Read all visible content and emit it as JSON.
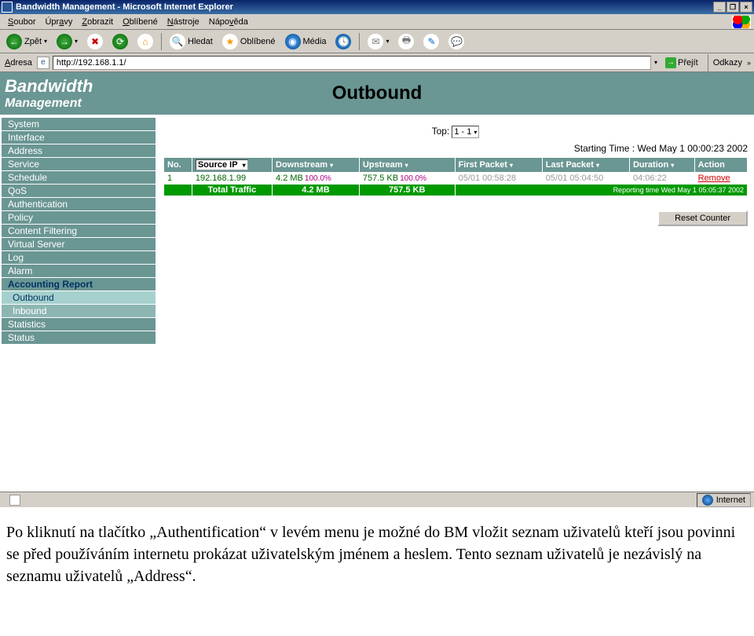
{
  "window": {
    "title": "Bandwidth Management - Microsoft Internet Explorer"
  },
  "menu": {
    "items": [
      "Soubor",
      "Úpravy",
      "Zobrazit",
      "Oblíbené",
      "Nástroje",
      "Nápověda"
    ]
  },
  "toolbar": {
    "back": "Zpět",
    "search": "Hledat",
    "favorites": "Oblíbené",
    "media": "Média"
  },
  "address": {
    "label": "Adresa",
    "url": "http://192.168.1.1/",
    "go": "Přejít",
    "links": "Odkazy"
  },
  "header": {
    "line1": "Bandwidth",
    "line2": "Management",
    "page_title": "Outbound"
  },
  "sidebar": {
    "items": [
      "System",
      "Interface",
      "Address",
      "Service",
      "Schedule",
      "QoS",
      "Authentication",
      "Policy",
      "Content Filtering",
      "Virtual Server",
      "Log",
      "Alarm",
      "Accounting Report",
      "Outbound",
      "Inbound",
      "Statistics",
      "Status"
    ]
  },
  "content": {
    "top_label": "Top:",
    "top_value": "1 - 1",
    "starting_time": "Starting Time : Wed May 1 00:00:23 2002",
    "columns": {
      "no": "No.",
      "source_sel": "Source IP",
      "down": "Downstream",
      "up": "Upstream",
      "first": "First Packet",
      "last": "Last Packet",
      "dur": "Duration",
      "action": "Action"
    },
    "row": {
      "no": "1",
      "ip": "192.168.1.99",
      "down": "4.2 MB",
      "down_pct": "100.0%",
      "up": "757.5 KB",
      "up_pct": "100.0%",
      "first": "05/01 00:58:28",
      "last": "05/01 05:04:50",
      "dur": "04:06:22",
      "action": "Remove"
    },
    "total": {
      "label": "Total Traffic",
      "down": "4.2 MB",
      "up": "757.5 KB"
    },
    "report_time": "Reporting time Wed May 1 05:05:37 2002",
    "reset_btn": "Reset Counter"
  },
  "status": {
    "zone": "Internet"
  },
  "paragraph": "Po kliknutí na tlačítko „Authentification“ v levém menu je možné do BM vložit seznam uživatelů kteří jsou povinni se před používáním internetu prokázat uživatelským jménem a heslem. Tento seznam uživatelů je nezávislý na seznamu uživatelů „Address“."
}
